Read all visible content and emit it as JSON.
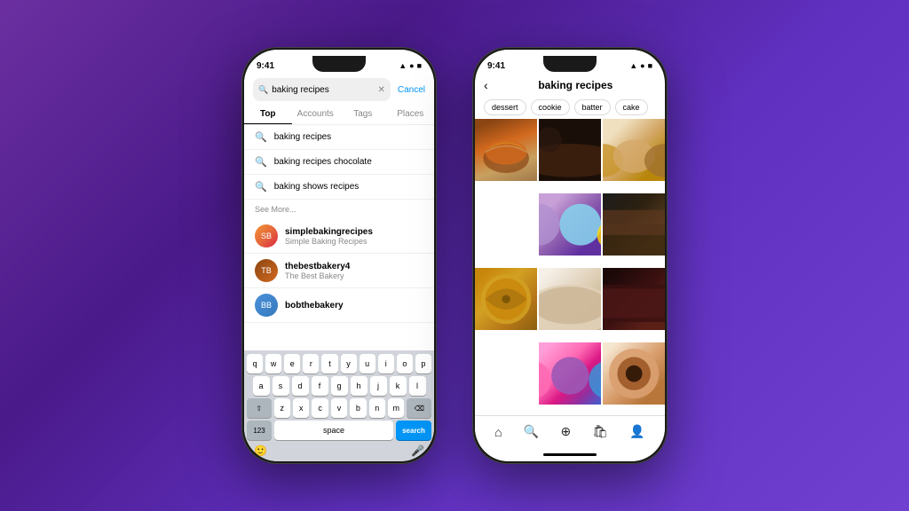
{
  "phone1": {
    "statusBar": {
      "time": "9:41",
      "icons": "▲ ● ■"
    },
    "searchBar": {
      "query": "baking recipes",
      "placeholder": "Search",
      "cancelLabel": "Cancel"
    },
    "tabs": [
      {
        "label": "Top",
        "active": true
      },
      {
        "label": "Accounts",
        "active": false
      },
      {
        "label": "Tags",
        "active": false
      },
      {
        "label": "Places",
        "active": false
      }
    ],
    "suggestions": [
      {
        "text": "baking recipes"
      },
      {
        "text": "baking recipes chocolate"
      },
      {
        "text": "baking shows recipes"
      }
    ],
    "seeMore": "See More...",
    "accounts": [
      {
        "name": "simplebakingrecipes",
        "desc": "Simple Baking Recipes"
      },
      {
        "name": "thebestbakery4",
        "desc": "The Best Bakery"
      },
      {
        "name": "bobthebakery",
        "desc": ""
      }
    ],
    "keyboard": {
      "rows": [
        [
          "q",
          "w",
          "e",
          "r",
          "t",
          "y",
          "u",
          "i",
          "o",
          "p"
        ],
        [
          "a",
          "s",
          "d",
          "f",
          "g",
          "h",
          "j",
          "k",
          "l"
        ],
        [
          "z",
          "x",
          "c",
          "v",
          "b",
          "n",
          "m"
        ]
      ],
      "bottomRow": {
        "numLabel": "123",
        "spaceLabel": "space",
        "searchLabel": "search"
      }
    }
  },
  "phone2": {
    "statusBar": {
      "time": "9:41",
      "icons": "▲ ● ■"
    },
    "header": {
      "backIcon": "‹",
      "title": "baking recipes"
    },
    "filters": [
      "dessert",
      "cookie",
      "batter",
      "cake"
    ],
    "navItems": [
      "🏠",
      "🔍",
      "➕",
      "🛍",
      "👤"
    ]
  }
}
